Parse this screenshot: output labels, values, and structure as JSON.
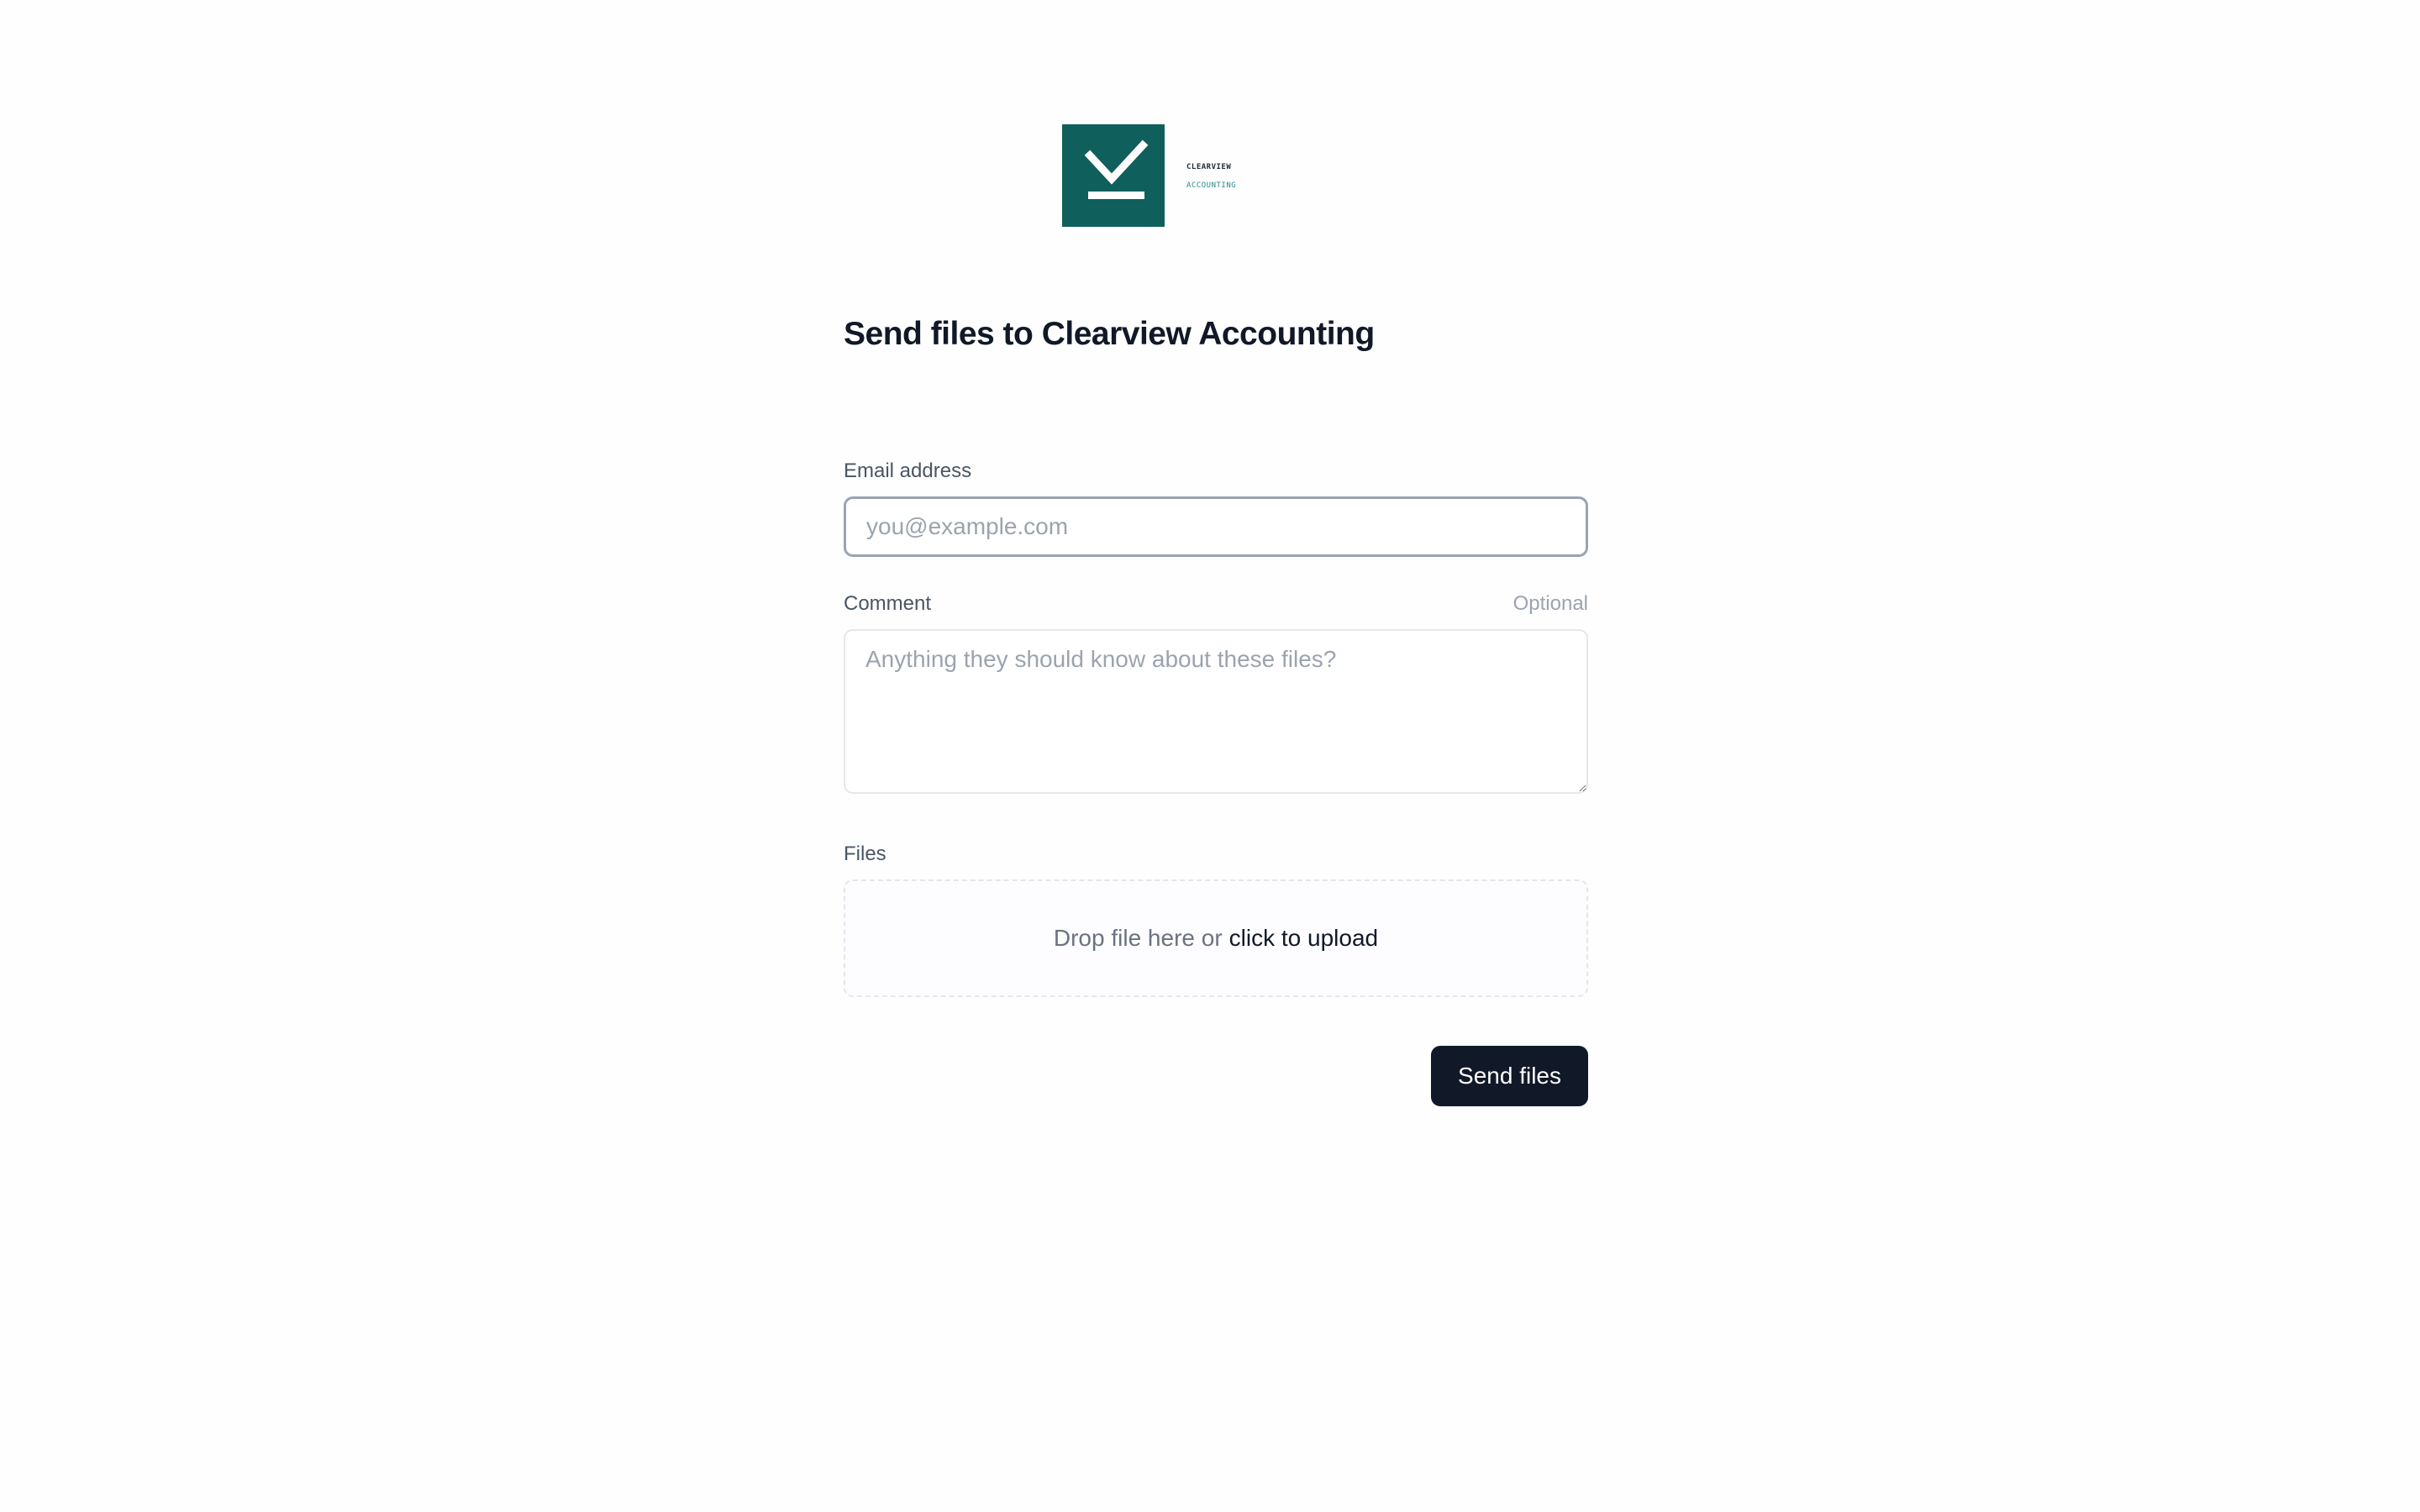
{
  "brand": {
    "logo_line1": "CLEARVIEW",
    "logo_line2": "ACCOUNTING",
    "logo_icon": "checkmark-download-icon",
    "logo_color": "#0f5f5c"
  },
  "form": {
    "title": "Send files to Clearview Accounting",
    "email": {
      "label": "Email address",
      "placeholder": "you@example.com",
      "value": ""
    },
    "comment": {
      "label": "Comment",
      "optional_label": "Optional",
      "placeholder": "Anything they should know about these files?",
      "value": ""
    },
    "files": {
      "label": "Files",
      "drop_text": "Drop file here or",
      "upload_link": "click to upload"
    },
    "submit_label": "Send files"
  },
  "colors": {
    "primary_button": "#111827",
    "brand_teal": "#0f5f5c"
  }
}
